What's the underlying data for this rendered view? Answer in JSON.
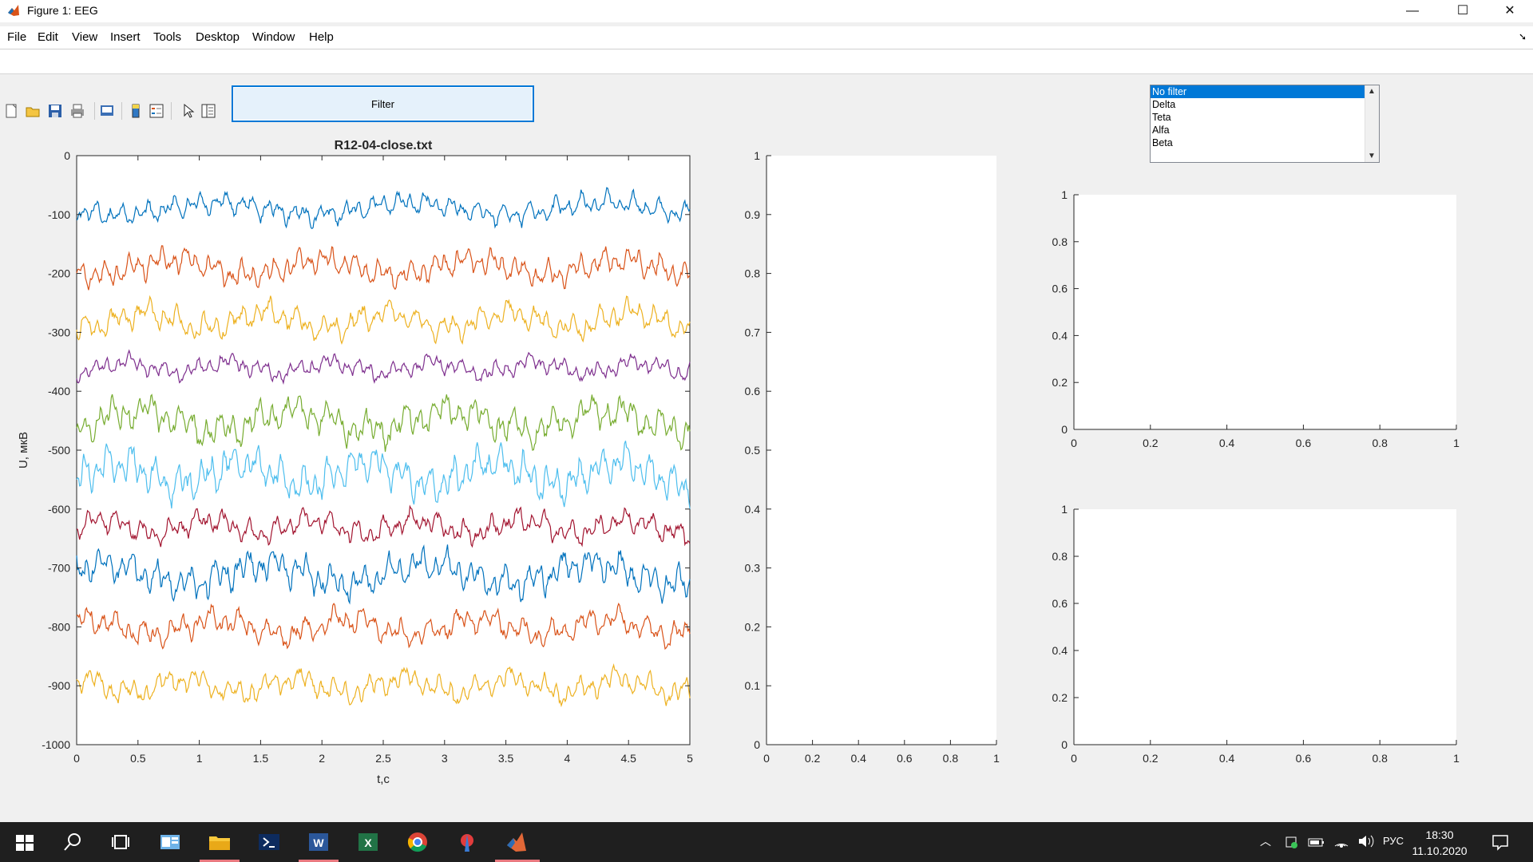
{
  "window": {
    "title": "Figure 1: EEG",
    "minimize": "—",
    "maximize": "☐",
    "close": "✕"
  },
  "menu": [
    "File",
    "Edit",
    "View",
    "Insert",
    "Tools",
    "Desktop",
    "Window",
    "Help"
  ],
  "toolbar_icons": [
    "new-figure-icon",
    "open-file-icon",
    "save-icon",
    "print-icon",
    "print-preview-icon",
    "colorbar-icon",
    "legend-icon",
    "pointer-icon",
    "property-inspector-icon"
  ],
  "filter_button": {
    "label": "Filter"
  },
  "filter_list": {
    "options": [
      "No filter",
      "Delta",
      "Teta",
      "Alfa",
      "Beta"
    ],
    "selected": "No filter"
  },
  "main_plot": {
    "title": "R12-04-close.txt",
    "xlabel": "t,c",
    "ylabel": "U, мкВ",
    "xticks": [
      "0",
      "0.5",
      "1",
      "1.5",
      "2",
      "2.5",
      "3",
      "3.5",
      "4",
      "4.5",
      "5"
    ],
    "yticks": [
      "0",
      "-100",
      "-200",
      "-300",
      "-400",
      "-500",
      "-600",
      "-700",
      "-800",
      "-900",
      "-1000"
    ]
  },
  "chart_data": [
    {
      "type": "line",
      "title": "R12-04-close.txt",
      "xlabel": "t,c",
      "ylabel": "U, мкВ",
      "xlim": [
        0,
        5
      ],
      "ylim": [
        -1000,
        0
      ],
      "grid": false,
      "series": [
        {
          "color": "#0072bd",
          "baseline": -90,
          "amplitude": 18
        },
        {
          "color": "#d95319",
          "baseline": -190,
          "amplitude": 22
        },
        {
          "color": "#edb120",
          "baseline": -280,
          "amplitude": 22
        },
        {
          "color": "#7e2f8e",
          "baseline": -360,
          "amplitude": 15
        },
        {
          "color": "#77ac30",
          "baseline": -450,
          "amplitude": 28
        },
        {
          "color": "#4dbeee",
          "baseline": -540,
          "amplitude": 32
        },
        {
          "color": "#a2142f",
          "baseline": -630,
          "amplitude": 20
        },
        {
          "color": "#0072bd",
          "baseline": -710,
          "amplitude": 28
        },
        {
          "color": "#d95319",
          "baseline": -800,
          "amplitude": 22
        },
        {
          "color": "#edb120",
          "baseline": -900,
          "amplitude": 20
        }
      ]
    },
    {
      "type": "line",
      "xlim": [
        0,
        1
      ],
      "ylim": [
        0,
        1
      ],
      "series": []
    },
    {
      "type": "line",
      "xlim": [
        0,
        1
      ],
      "ylim": [
        0,
        1
      ],
      "series": []
    },
    {
      "type": "line",
      "xlim": [
        0,
        1
      ],
      "ylim": [
        0,
        1
      ],
      "series": []
    }
  ],
  "axes2": {
    "xticks": [
      "0",
      "0.2",
      "0.4",
      "0.6",
      "0.8",
      "1"
    ],
    "yticks": [
      "1",
      "0.9",
      "0.8",
      "0.7",
      "0.6",
      "0.5",
      "0.4",
      "0.3",
      "0.2",
      "0.1",
      "0"
    ]
  },
  "axes3": {
    "xticks": [
      "0",
      "0.2",
      "0.4",
      "0.6",
      "0.8",
      "1"
    ],
    "yticks": [
      "1",
      "0.8",
      "0.6",
      "0.4",
      "0.2",
      "0"
    ]
  },
  "axes4": {
    "xticks": [
      "0",
      "0.2",
      "0.4",
      "0.6",
      "0.8",
      "1"
    ],
    "yticks": [
      "1",
      "0.8",
      "0.6",
      "0.4",
      "0.2",
      "0"
    ]
  },
  "taskbar": {
    "apps": [
      "windows-start-icon",
      "search-icon",
      "task-view-icon",
      "outlook-icon",
      "file-explorer-icon",
      "powershell-icon",
      "word-icon",
      "excel-icon",
      "chrome-icon",
      "app-icon",
      "matlab-icon"
    ],
    "language": "РУС",
    "time": "18:30",
    "date": "11.10.2020"
  }
}
